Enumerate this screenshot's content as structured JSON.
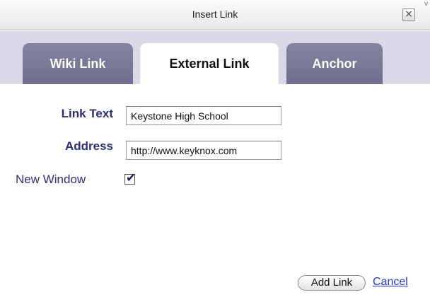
{
  "window": {
    "title": "Insert Link",
    "close_glyph": "×",
    "corner_glyph": "v"
  },
  "tabs": [
    {
      "label": "Wiki Link",
      "active": false
    },
    {
      "label": "External Link",
      "active": true
    },
    {
      "label": "Anchor",
      "active": false
    }
  ],
  "form": {
    "link_text_label": "Link Text",
    "link_text_value": "Keystone High School",
    "address_label": "Address",
    "address_value": "http://www.keyknox.com",
    "new_window_label": "New Window",
    "new_window_checked": true,
    "check_glyph": "✔"
  },
  "actions": {
    "add_link_label": "Add Link",
    "cancel_label": "Cancel"
  },
  "colors": {
    "tab_inactive": "#7a7a98",
    "tab_strip_bg": "#d9d9e8",
    "label_color": "#2b2f7a",
    "link_color": "#1f3fcc"
  }
}
